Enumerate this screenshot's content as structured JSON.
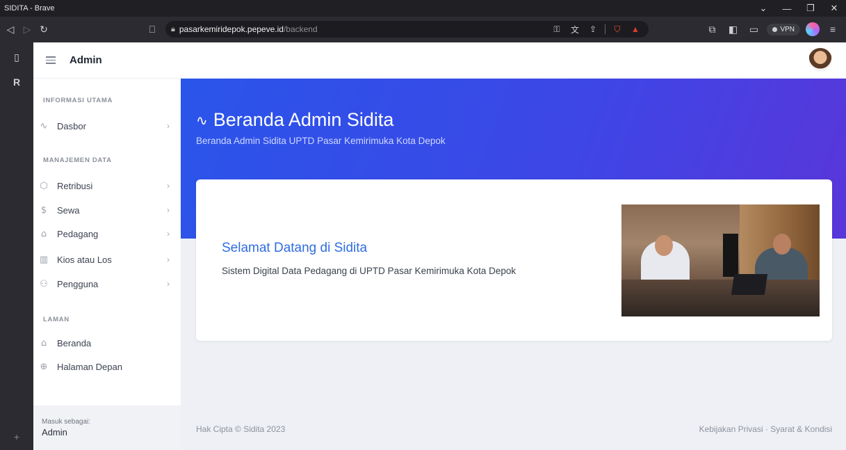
{
  "browser": {
    "window_title": "SIDITA - Brave",
    "url_host": "pasarkemiridepok.pepeve.id",
    "url_path": "/backend",
    "vpn_label": "VPN",
    "controls": {
      "minimize": "—",
      "restore": "❐",
      "close": "✕",
      "dropdown": "⌄"
    }
  },
  "header": {
    "title": "Admin"
  },
  "sidebar": {
    "sections": [
      {
        "title": "INFORMASI UTAMA"
      },
      {
        "title": "MANAJEMEN DATA"
      },
      {
        "title": "LAMAN"
      }
    ],
    "items": [
      {
        "label": "Dasbor",
        "icon": "activity-icon",
        "has_submenu": true
      },
      {
        "label": "Retribusi",
        "icon": "box-icon",
        "has_submenu": true
      },
      {
        "label": "Sewa",
        "icon": "dollar-icon",
        "has_submenu": true
      },
      {
        "label": "Pedagang",
        "icon": "store-icon",
        "has_submenu": true
      },
      {
        "label": "Kios atau Los",
        "icon": "map-icon",
        "has_submenu": true
      },
      {
        "label": "Pengguna",
        "icon": "users-icon",
        "has_submenu": true
      },
      {
        "label": "Beranda",
        "icon": "home-icon",
        "has_submenu": false
      },
      {
        "label": "Halaman Depan",
        "icon": "globe-icon",
        "has_submenu": false
      }
    ],
    "footer": {
      "caption": "Masuk sebagai:",
      "user": "Admin"
    }
  },
  "hero": {
    "title": "Beranda Admin Sidita",
    "subtitle": "Beranda Admin Sidita UPTD Pasar Kemirimuka Kota Depok"
  },
  "welcome_card": {
    "title": "Selamat Datang di Sidita",
    "description": "Sistem Digital Data Pedagang di UPTD Pasar Kemirimuka Kota Depok"
  },
  "footer": {
    "copyright": "Hak Cipta © Sidita 2023",
    "links": "Kebijakan Privasi · Syarat & Kondisi"
  },
  "colors": {
    "hero_gradient_start": "#2a55ea",
    "hero_gradient_end": "#5936da",
    "card_title": "#2f6de0",
    "sidebar_bg": "#ffffff",
    "page_bg": "#eef0f5"
  }
}
